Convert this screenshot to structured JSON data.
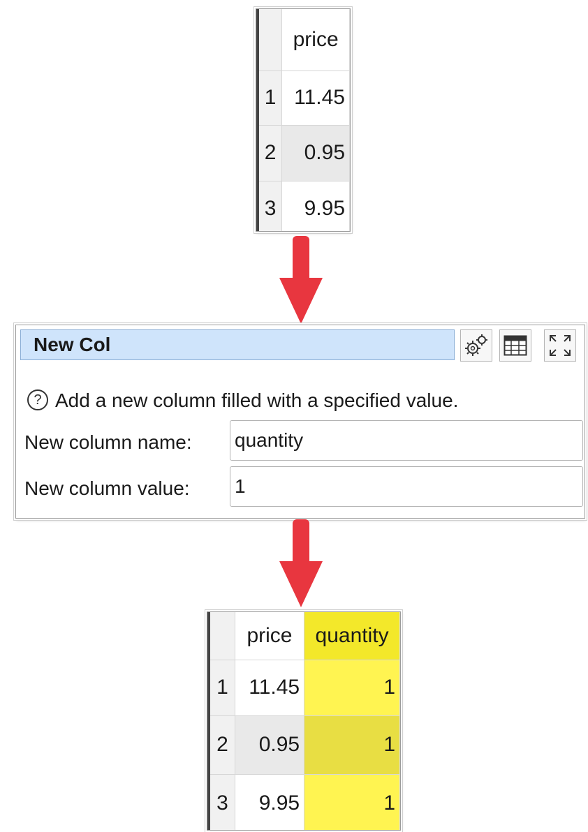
{
  "input_table": {
    "header": "price",
    "rows": [
      {
        "n": "1",
        "price": "11.45"
      },
      {
        "n": "2",
        "price": "0.95"
      },
      {
        "n": "3",
        "price": "9.95"
      }
    ]
  },
  "panel": {
    "title": "New Col",
    "description": "Add a new column filled with a specified value.",
    "help_icon_glyph": "?",
    "fields": {
      "name_label": "New column name:",
      "name_value": "quantity",
      "value_label": "New column value:",
      "value_value": "1"
    },
    "buttons": [
      "gears-icon",
      "table-icon",
      "maximize-icon"
    ]
  },
  "output_table": {
    "headers": [
      "price",
      "quantity"
    ],
    "rows": [
      {
        "n": "1",
        "price": "11.45",
        "quantity": "1"
      },
      {
        "n": "2",
        "price": "0.95",
        "quantity": "1"
      },
      {
        "n": "3",
        "price": "9.95",
        "quantity": "1"
      }
    ]
  },
  "colors": {
    "arrow": "#e8363f",
    "highlight": "#fff451",
    "title_bg": "#cfe4fb"
  }
}
